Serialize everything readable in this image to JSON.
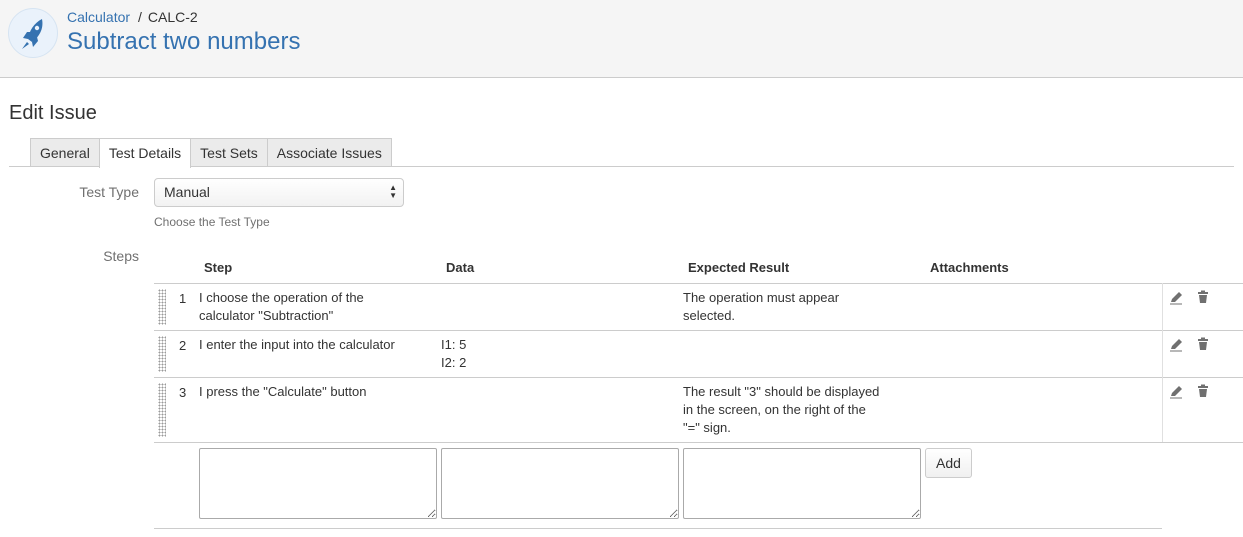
{
  "header": {
    "project": "Calculator",
    "separator": "/",
    "issue_key": "CALC-2",
    "issue_title": "Subtract two numbers",
    "avatar_icon": "rocket-icon"
  },
  "page": {
    "title": "Edit Issue"
  },
  "tabs": [
    {
      "label": "General",
      "active": false
    },
    {
      "label": "Test Details",
      "active": true
    },
    {
      "label": "Test Sets",
      "active": false
    },
    {
      "label": "Associate Issues",
      "active": false
    }
  ],
  "test_type": {
    "label": "Test Type",
    "value": "Manual",
    "help": "Choose the Test Type"
  },
  "steps": {
    "label": "Steps",
    "columns": [
      "Step",
      "Data",
      "Expected Result",
      "Attachments"
    ],
    "rows": [
      {
        "num": "1",
        "step": [
          "I choose the operation of the",
          "calculator \"Subtraction\""
        ],
        "data": [],
        "expected": [
          "The operation must appear",
          "selected."
        ]
      },
      {
        "num": "2",
        "step": [
          "I enter the input into the calculator"
        ],
        "data": [
          "I1: 5",
          "I2: 2"
        ],
        "expected": []
      },
      {
        "num": "3",
        "step": [
          "I press the \"Calculate\" button"
        ],
        "data": [],
        "expected": [
          "The result \"3\" should be displayed",
          "in the screen, on the right of the",
          "\"=\" sign."
        ]
      }
    ],
    "row_icons": [
      "pencil-icon",
      "trash-icon"
    ],
    "add_label": "Add"
  },
  "colors": {
    "link": "#3572b0",
    "border": "#cccccc",
    "header_bg": "#f5f5f5"
  }
}
